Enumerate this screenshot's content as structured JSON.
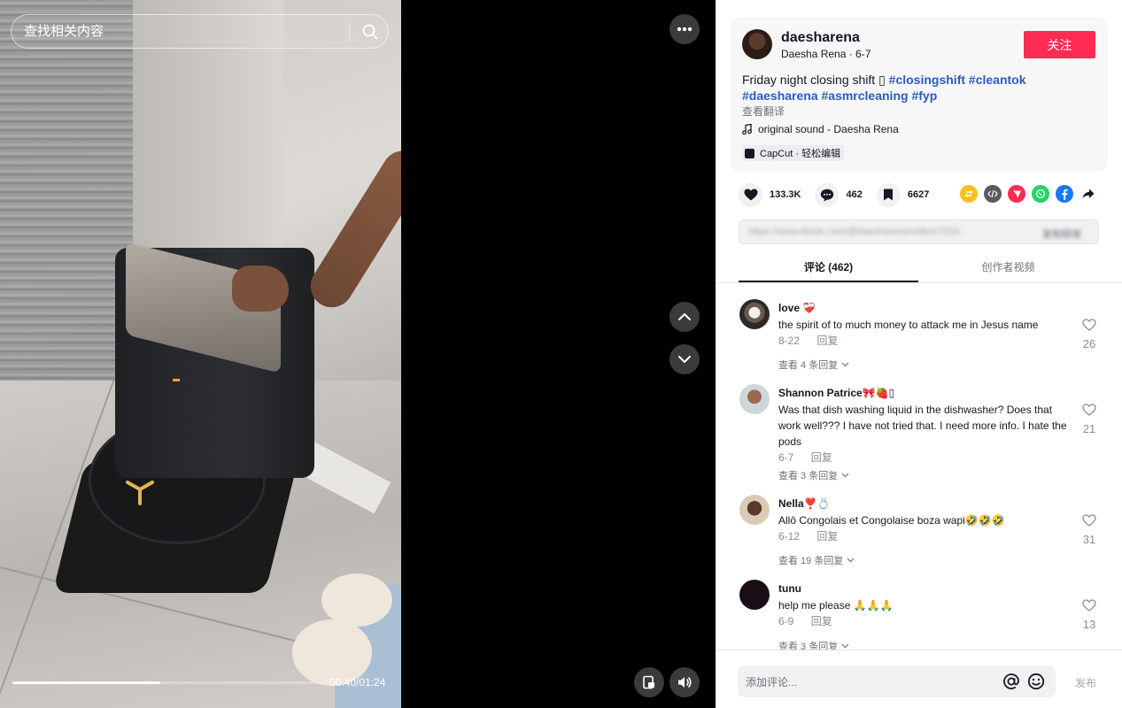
{
  "search": {
    "placeholder": "查找相关内容"
  },
  "player": {
    "current_time": "00:40",
    "duration": "01:24",
    "time_display": "00:40/01:24",
    "progress_fraction": 0.476
  },
  "author": {
    "username": "daesharena",
    "display_name": "Daesha Rena",
    "date": "6-7",
    "subline": "Daesha Rena · 6-7",
    "follow_label": "关注"
  },
  "description": {
    "text": "Friday night closing shift ▯",
    "hashtags": [
      "#closingshift",
      "#cleantok",
      "#daesharena",
      "#asmrcleaning",
      "#fyp"
    ],
    "translate_label": "查看翻译"
  },
  "music": {
    "label": "original sound - Daesha Rena"
  },
  "capcut": {
    "label": "CapCut · 轻松编辑"
  },
  "stats": {
    "likes": "133.3K",
    "comments": "462",
    "saves": "6627"
  },
  "share_icons": [
    "repost-icon",
    "embed-icon",
    "send-icon",
    "whatsapp-icon",
    "facebook-icon",
    "share-arrow-icon"
  ],
  "colors": {
    "accent": "#fe2c55",
    "hashtag": "#2b5db9",
    "repost": "#fcc01a",
    "embed": "#5a5b62",
    "send": "#fe2c55",
    "whatsapp": "#25d366",
    "facebook": "#1877f2"
  },
  "link": {
    "url": "https://www.tiktok.com/@daesharena/video/7520...",
    "copy_label": "复制链接"
  },
  "tabs": {
    "comments": "评论 (462)",
    "creator_videos": "创作者视频"
  },
  "comments": [
    {
      "name": "love ❤️‍🩹",
      "text": "the spirit of to much money to attack me in Jesus name",
      "date": "8-22",
      "reply": "回复",
      "likes": "26",
      "more_replies": "查看 4 条回复"
    },
    {
      "name": "Shannon Patrice🎀🍓▯",
      "text": "Was that dish washing liquid in the dishwasher? Does that work well??? I have not tried that. I need more info. I hate the pods",
      "date": "6-7",
      "reply": "回复",
      "likes": "21",
      "more_replies": "查看 3 条回复"
    },
    {
      "name": "Nella❣️💍",
      "text": "Allô Congolais et Congolaise boza wapi🤣🤣🤣",
      "date": "6-12",
      "reply": "回复",
      "likes": "31",
      "more_replies": "查看 19 条回复"
    },
    {
      "name": "tunu",
      "text": "help me please 🙏🙏🙏",
      "date": "6-9",
      "reply": "回复",
      "likes": "13",
      "more_replies": "查看 3 条回复"
    }
  ],
  "comment_box": {
    "placeholder": "添加评论...",
    "post_label": "发布"
  }
}
